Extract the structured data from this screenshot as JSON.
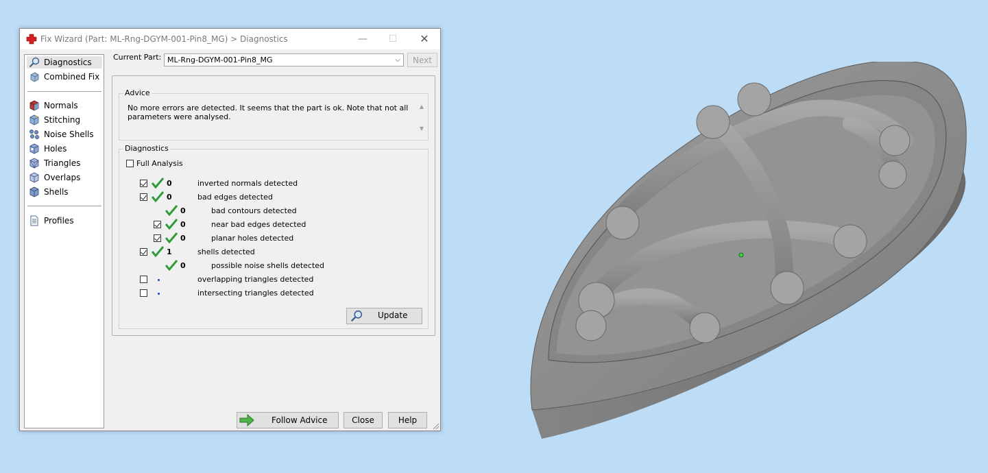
{
  "window": {
    "title": "Fix Wizard (Part: ML-Rng-DGYM-001-Pin8_MG) > Diagnostics",
    "minimize": "—",
    "maximize": "☐",
    "close": "✕"
  },
  "nav": {
    "items": [
      {
        "label": "Diagnostics",
        "icon": "magnifier-icon",
        "selected": true
      },
      {
        "label": "Combined Fix",
        "icon": "combined-fix-icon"
      },
      {
        "label": "Normals",
        "icon": "normals-cube-icon"
      },
      {
        "label": "Stitching",
        "icon": "stitching-cube-icon"
      },
      {
        "label": "Noise Shells",
        "icon": "noise-shells-icon"
      },
      {
        "label": "Holes",
        "icon": "holes-cube-icon"
      },
      {
        "label": "Triangles",
        "icon": "triangles-cube-icon"
      },
      {
        "label": "Overlaps",
        "icon": "overlaps-cube-icon"
      },
      {
        "label": "Shells",
        "icon": "shells-cube-icon"
      },
      {
        "label": "Profiles",
        "icon": "profiles-document-icon"
      }
    ]
  },
  "current_part": {
    "label": "Current Part:",
    "value": "ML-Rng-DGYM-001-Pin8_MG",
    "next_label": "Next"
  },
  "advice": {
    "title": "Advice",
    "text": "No more errors are detected. It seems that the part is ok. Note that not all parameters were analysed."
  },
  "diagnostics": {
    "title": "Diagnostics",
    "full_analysis_label": "Full Analysis",
    "full_analysis_checked": false,
    "rows": [
      {
        "checked": true,
        "status": "ok",
        "count": "0",
        "label": "inverted normals detected"
      },
      {
        "checked": true,
        "status": "ok",
        "count": "0",
        "label": "bad edges detected"
      },
      {
        "checked": null,
        "status": "ok",
        "count": "0",
        "label": "bad contours detected"
      },
      {
        "checked": true,
        "status": "ok",
        "count": "0",
        "label": "near bad edges detected"
      },
      {
        "checked": true,
        "status": "ok",
        "count": "0",
        "label": "planar holes detected"
      },
      {
        "checked": true,
        "status": "ok",
        "count": "1",
        "label": "shells detected"
      },
      {
        "checked": null,
        "status": "ok",
        "count": "0",
        "label": "possible noise shells detected"
      },
      {
        "checked": false,
        "status": "pending",
        "count": "",
        "label": "overlapping triangles detected"
      },
      {
        "checked": false,
        "status": "pending",
        "count": "",
        "label": "intersecting triangles detected"
      }
    ],
    "update_label": "Update"
  },
  "footer": {
    "follow_advice_label": "Follow Advice",
    "close_label": "Close",
    "help_label": "Help"
  },
  "colors": {
    "desktop": "#bddcf6",
    "tick_green": "#2e9b3a",
    "pending_dot": "#1a3cc8",
    "model_grey": "#8a8a8a"
  }
}
